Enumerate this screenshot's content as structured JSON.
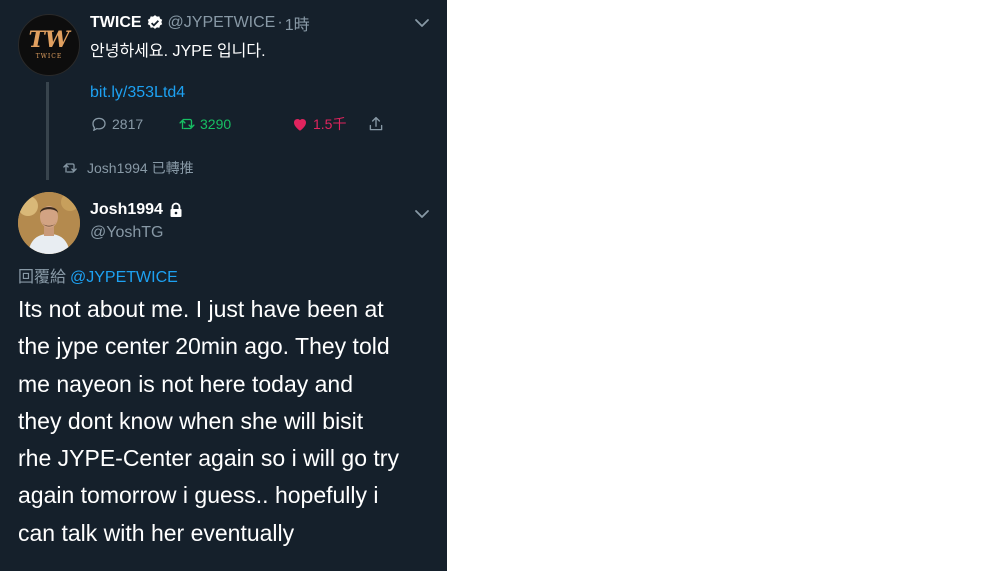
{
  "tweet_main": {
    "author_name": "TWICE",
    "author_handle": "@JYPETWICE",
    "separator": "·",
    "time": "1時",
    "avatar_text": "TW",
    "avatar_subtext": "TWICE",
    "text": "안녕하세요. JYPE 입니다.",
    "link": "bit.ly/353Ltd4",
    "reply_count": "2817",
    "retweet_count": "3290",
    "like_count": "1.5千"
  },
  "retweet_context": {
    "text": "Josh1994 已轉推"
  },
  "tweet_reply": {
    "author_name": "Josh1994",
    "author_handle": "@YoshTG",
    "reply_prefix": "回覆給",
    "reply_mention": "@JYPETWICE",
    "body_lines": [
      "Its not about me. I just have been at",
      "the jype center 20min ago. They told",
      "me nayeon is not here today and",
      "they dont know when she will bisit",
      "rhe JYPE-Center again so i will go try",
      "again tomorrow i guess.. hopefully i",
      "can talk with her eventually"
    ]
  },
  "colors": {
    "background": "#15202b",
    "link": "#1da1f2",
    "muted": "#8899a6",
    "retweet_active": "#17bf63",
    "like_active": "#e0245e"
  }
}
